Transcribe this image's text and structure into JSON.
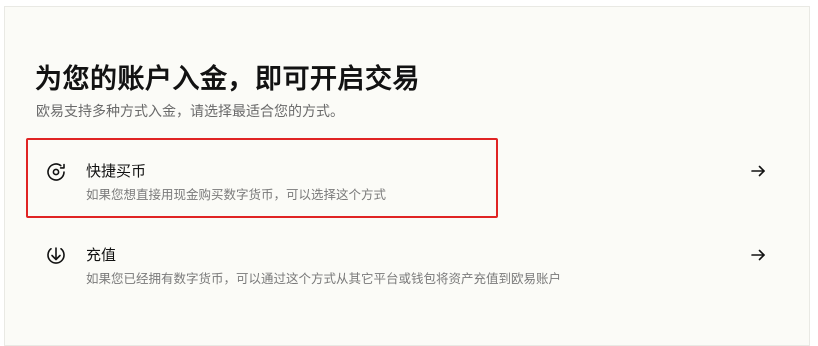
{
  "header": {
    "title": "为您的账户入金，即可开启交易",
    "subtitle": "欧易支持多种方式入金，请选择最适合您的方式。"
  },
  "options": [
    {
      "label": "快捷买币",
      "description": "如果您想直接用现金购买数字货币，可以选择这个方式",
      "icon": "coin-exchange-icon",
      "highlighted": true
    },
    {
      "label": "充值",
      "description": "如果您已经拥有数字货币，可以通过这个方式从其它平台或钱包将资产充值到欧易账户",
      "icon": "download-circle-icon",
      "highlighted": false
    }
  ],
  "colors": {
    "background": "#fbfbf7",
    "highlight_border": "#e02424",
    "text_primary": "#121212",
    "text_secondary": "#7a7a7a"
  }
}
